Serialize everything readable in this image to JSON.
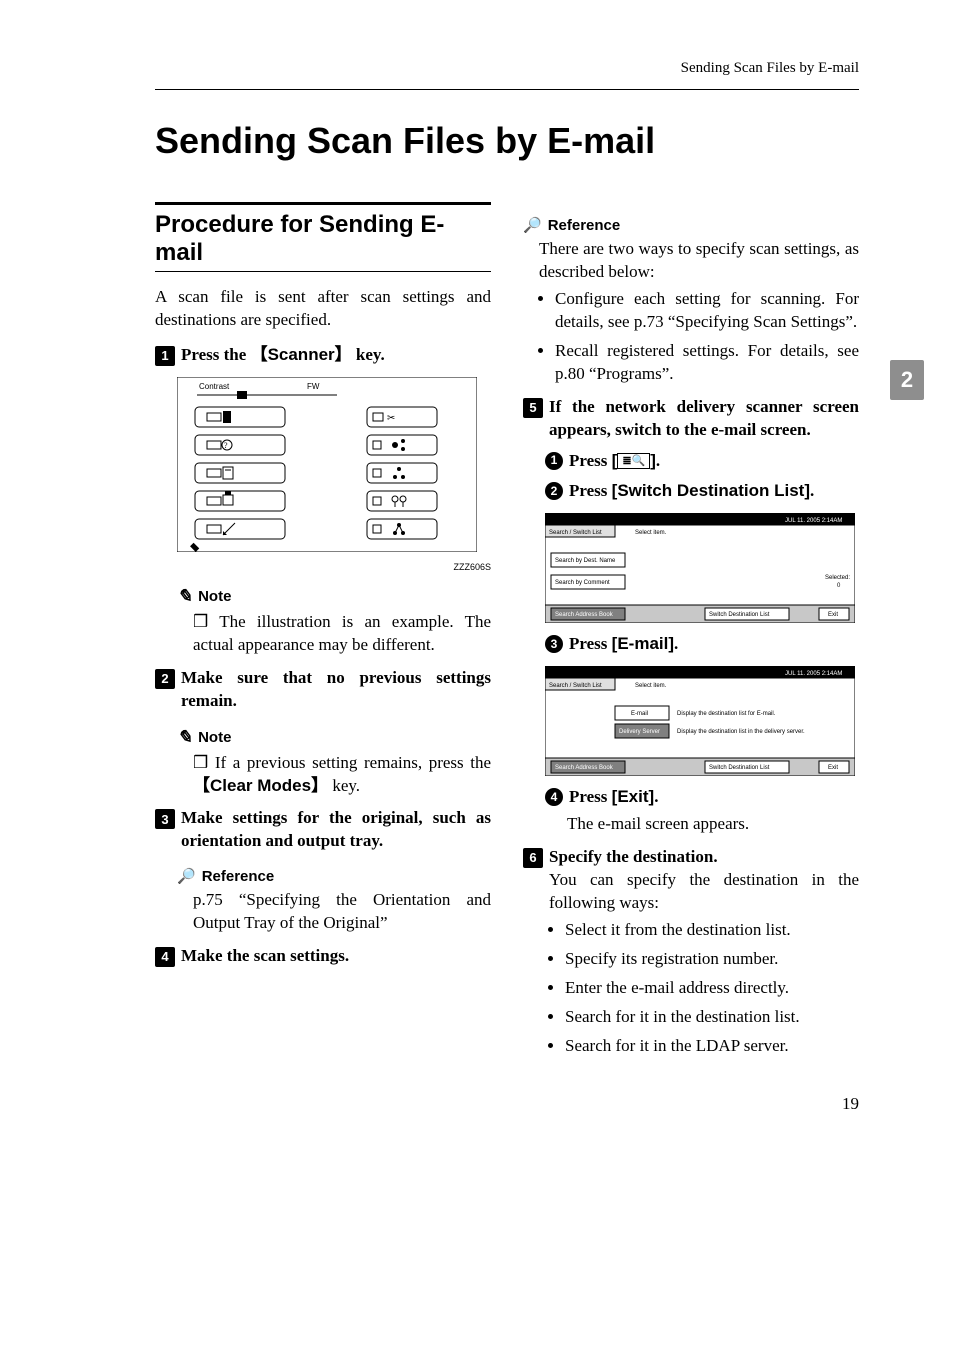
{
  "running_head": "Sending Scan Files by E-mail",
  "title": "Sending Scan Files by E-mail",
  "side_tab": "2",
  "section_heading": "Procedure for Sending E-mail",
  "lead": "A scan file is sent after scan settings and destinations are specified.",
  "step1": {
    "prefix": "Press the ",
    "key": "Scanner",
    "suffix": " key.",
    "img_code": "ZZZ606S"
  },
  "note_label": "Note",
  "reference_label": "Reference",
  "note1": "The illustration is an example. The actual appearance may be different.",
  "step2": "Make sure that no previous settings remain.",
  "note2_prefix": "If a previous setting remains, press the ",
  "note2_key": "Clear Modes",
  "note2_suffix": " key.",
  "step3": "Make settings for the original, such as orientation and output tray.",
  "ref3": "p.75 “Specifying the Orientation and Output Tray of the Original”",
  "step4": "Make the scan settings.",
  "ref4_intro": "There are two ways to specify scan settings, as described below:",
  "ref4_bullets": [
    "Configure each setting for scanning. For details, see p.73 “Specifying Scan Settings”.",
    "Recall registered settings. For details, see p.80 “Programs”."
  ],
  "step5": "If the network delivery scanner screen appears, switch to the e-mail screen.",
  "sub5_1_prefix": "Press ",
  "sub5_1_suffix": ".",
  "sub5_2_prefix": "Press ",
  "sub5_2_key": "Switch Destination List",
  "sub5_2_suffix": ".",
  "sub5_3_prefix": "Press ",
  "sub5_3_key": "E-mail",
  "sub5_3_suffix": ".",
  "sub5_4_prefix": "Press ",
  "sub5_4_key": "Exit",
  "sub5_4_suffix": ".",
  "sub5_4_body": "The e-mail screen appears.",
  "step6": "Specify the destination.",
  "step6_body": "You can specify the destination in the following ways:",
  "step6_bullets": [
    "Select it from the destination list.",
    "Specify its registration number.",
    "Enter the e-mail address directly.",
    "Search for it in the destination list.",
    "Search for it in the LDAP server."
  ],
  "screen1": {
    "header_left": "Search / Switch List",
    "header_mid": "Select item.",
    "btn1": "Search by Dest. Name",
    "btn2": "Search by Comment",
    "btn3": "Search Address Book",
    "btn4": "Switch Destination List",
    "btn5": "Exit",
    "selected": "Selected:",
    "selected_n": "0",
    "timestamp": "JUL    11. 2005    2:14AM"
  },
  "screen2": {
    "header_left": "Search / Switch List",
    "header_mid": "Select item.",
    "opt1": "E-mail",
    "opt1_desc": "Display the destination list for E-mail.",
    "opt2": "Delivery Server",
    "opt2_desc": "Display the destination list in the delivery server.",
    "btn3": "Search Address Book",
    "btn4": "Switch Destination List",
    "btn5": "Exit",
    "timestamp": "JUL    11. 2005    2:14AM"
  },
  "page_number": "19"
}
